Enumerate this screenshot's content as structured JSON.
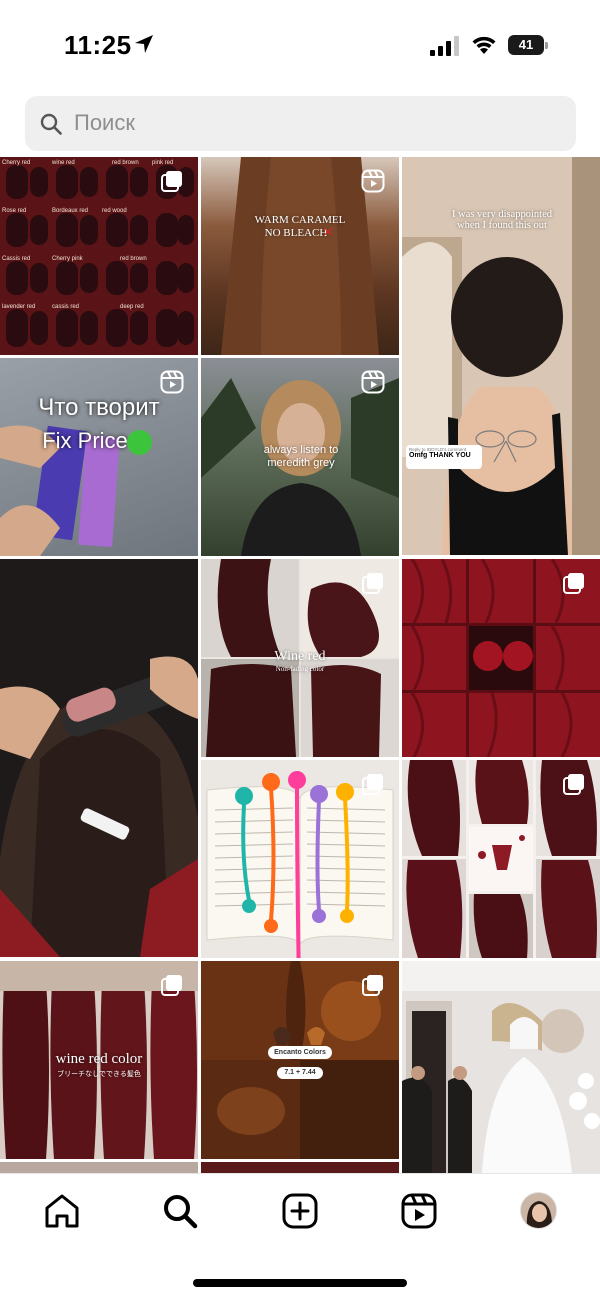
{
  "status_bar": {
    "time": "11:25",
    "battery_level": "41"
  },
  "search": {
    "placeholder": "Поиск"
  },
  "grid": {
    "tiles": [
      {
        "id": "hair-chart",
        "badge": "multi-icon"
      },
      {
        "id": "warm-caramel",
        "badge": "reel-icon",
        "caption": "WARM CARAMEL",
        "caption2": "NO BLEACH"
      },
      {
        "id": "tattoo-back",
        "caption": "I was very disappointed when I found this out",
        "comment_reply": "Reply to IDDYLD's comment",
        "comment_text": "Omfg THANK YOU"
      },
      {
        "id": "fix-price",
        "badge": "reel-icon",
        "caption": "Что творит",
        "caption2": "Fix Price"
      },
      {
        "id": "meredith",
        "badge": "reel-icon",
        "caption": "always listen to meredith grey"
      },
      {
        "id": "brush-styling"
      },
      {
        "id": "wine-red-collage",
        "badge": "multi-icon",
        "caption": "Wine red",
        "caption2": "Non-fading color"
      },
      {
        "id": "red-hair-collage",
        "badge": "multi-icon"
      },
      {
        "id": "bookmarks",
        "badge": "multi-icon"
      },
      {
        "id": "burgundy-collage",
        "badge": "multi-icon"
      },
      {
        "id": "wine-red-color",
        "badge": "multi-icon",
        "caption": "wine red color",
        "caption2": "ブリーチなしでできる髪色"
      },
      {
        "id": "encanto",
        "badge": "multi-icon",
        "caption": "Encanto Colors",
        "caption2": "7.1 + 7.44"
      },
      {
        "id": "bride"
      }
    ],
    "hair_chart_labels": [
      "Cherry red",
      "wine red",
      "red brown",
      "pink red",
      "Rose red",
      "Bordeaux red",
      "red wood",
      "Cassis red",
      "Cherry pink",
      "red brown",
      "lavender red",
      "cassis red",
      "deep red"
    ]
  },
  "nav": {
    "items": [
      "home-icon",
      "search-icon",
      "create-icon",
      "reels-icon",
      "profile-avatar"
    ],
    "active": "search-icon"
  },
  "colors": {
    "background": "#ffffff",
    "search_bg": "#efefef",
    "placeholder": "#8e8e8e"
  }
}
